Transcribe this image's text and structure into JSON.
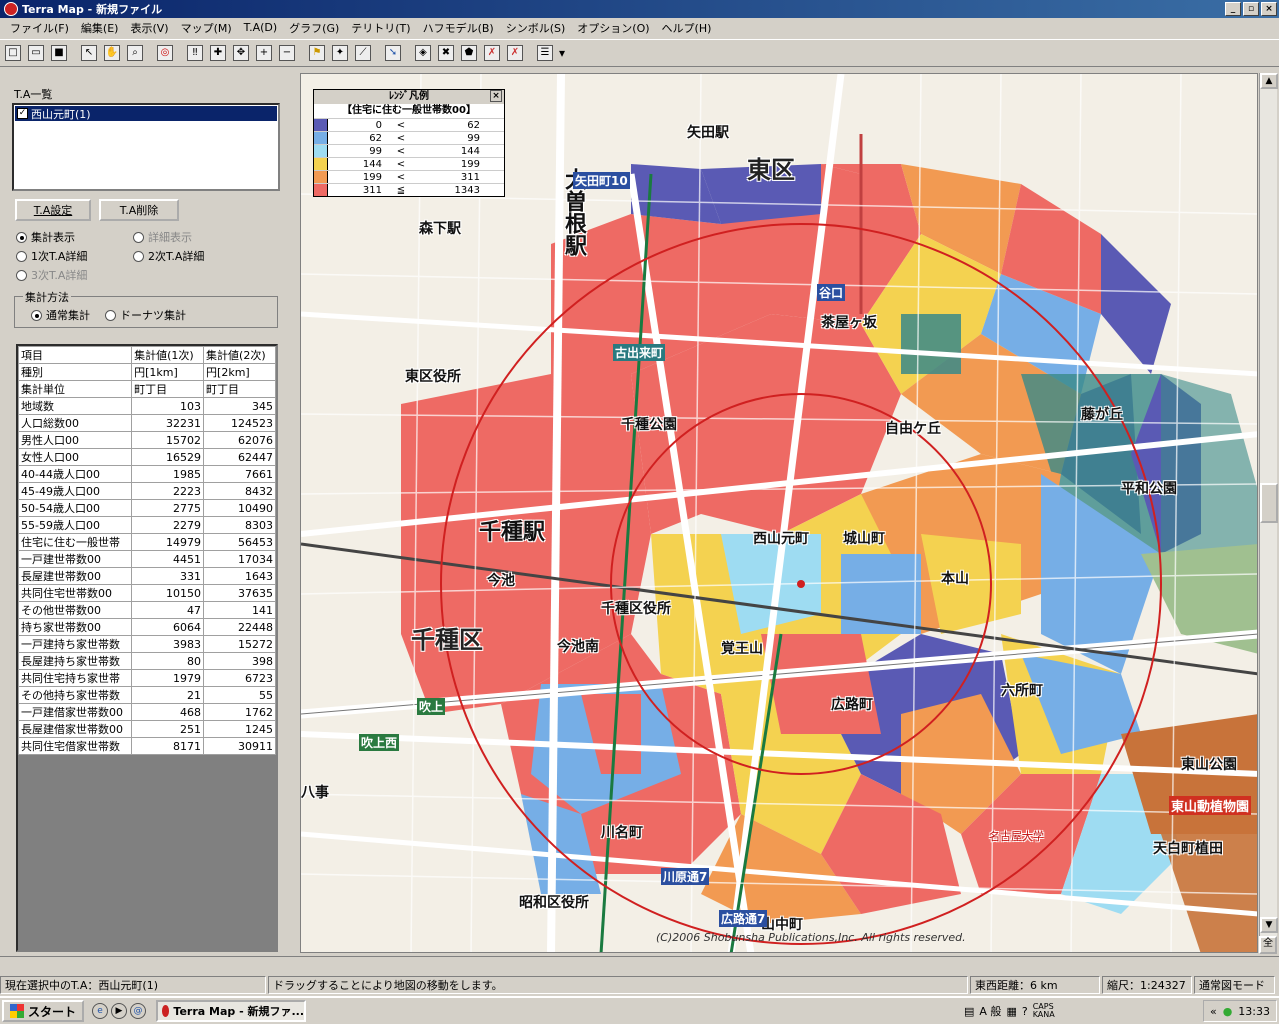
{
  "window": {
    "title": "Terra Map - 新規ファイル"
  },
  "menu": [
    "ファイル(F)",
    "編集(E)",
    "表示(V)",
    "マップ(M)",
    "T.A(D)",
    "グラフ(G)",
    "テリトリ(T)",
    "ハフモデル(B)",
    "シンボル(S)",
    "オプション(O)",
    "ヘルプ(H)"
  ],
  "left": {
    "ta_list_label": "T.A一覧",
    "ta_items": [
      "西山元町(1)"
    ],
    "btn_ta_setting": "T.A設定",
    "btn_ta_delete": "T.A削除",
    "radio_summary": "集計表示",
    "radio_detail": "詳細表示",
    "radio_ta1": "1次T.A詳細",
    "radio_ta2": "2次T.A詳細",
    "radio_ta3": "3次T.A詳細",
    "method_group": "集計方法",
    "method_normal": "通常集計",
    "method_donut": "ドーナツ集計"
  },
  "table": {
    "headers": [
      "項目",
      "集計値(1次)",
      "集計値(2次)"
    ],
    "rows": [
      [
        "種別",
        "円[1km]",
        "円[2km]"
      ],
      [
        "集計単位",
        "町丁目",
        "町丁目"
      ],
      [
        "地域数",
        "103",
        "345"
      ],
      [
        "人口総数00",
        "32231",
        "124523"
      ],
      [
        "男性人口00",
        "15702",
        "62076"
      ],
      [
        "女性人口00",
        "16529",
        "62447"
      ],
      [
        "40-44歳人口00",
        "1985",
        "7661"
      ],
      [
        "45-49歳人口00",
        "2223",
        "8432"
      ],
      [
        "50-54歳人口00",
        "2775",
        "10490"
      ],
      [
        "55-59歳人口00",
        "2279",
        "8303"
      ],
      [
        "住宅に住む一般世帯",
        "14979",
        "56453"
      ],
      [
        "一戸建世帯数00",
        "4451",
        "17034"
      ],
      [
        "長屋建世帯数00",
        "331",
        "1643"
      ],
      [
        "共同住宅世帯数00",
        "10150",
        "37635"
      ],
      [
        "その他世帯数00",
        "47",
        "141"
      ],
      [
        "持ち家世帯数00",
        "6064",
        "22448"
      ],
      [
        "一戸建持ち家世帯数",
        "3983",
        "15272"
      ],
      [
        "長屋建持ち家世帯数",
        "80",
        "398"
      ],
      [
        "共同住宅持ち家世帯",
        "1979",
        "6723"
      ],
      [
        "その他持ち家世帯数",
        "21",
        "55"
      ],
      [
        "一戸建借家世帯数00",
        "468",
        "1762"
      ],
      [
        "長屋建借家世帯数00",
        "251",
        "1245"
      ],
      [
        "共同住宅借家世帯数",
        "8171",
        "30911"
      ]
    ]
  },
  "legend": {
    "title": "ﾚﾝｼﾞ凡例",
    "subtitle": "【住宅に住む一般世帯数00】",
    "rows": [
      {
        "color": "#5a5ab4",
        "lo": "0",
        "op": "<",
        "hi": "62"
      },
      {
        "color": "#76aee6",
        "lo": "62",
        "op": "<",
        "hi": "99"
      },
      {
        "color": "#9edcf2",
        "lo": "99",
        "op": "<",
        "hi": "144"
      },
      {
        "color": "#f4d250",
        "lo": "144",
        "op": "<",
        "hi": "199"
      },
      {
        "color": "#f29a52",
        "lo": "199",
        "op": "<",
        "hi": "311"
      },
      {
        "color": "#ee6a64",
        "lo": "311",
        "op": "≦",
        "hi": "1343"
      }
    ]
  },
  "map": {
    "labels": {
      "higashi_ku": "東区",
      "chikusa_ku": "千種区",
      "chikusa_station": "千種駅",
      "chikusa_kuyakusho": "千種区役所",
      "imaike": "今池",
      "ozone": "大曽根駅",
      "yada": "矢田駅",
      "morishita": "森下駅",
      "higashi_kuyakusho": "東区役所",
      "showa_kuyakusho": "昭和区役所",
      "chayagasaka": "茶屋ヶ坂",
      "nishiyama_motomachi": "西山元町",
      "kakuozan": "覚王山",
      "fujigaoka": "藤が丘",
      "higashiyama": "東山公園",
      "heiwa_koen": "平和公園",
      "motoyama": "本山",
      "yagoto": "八事",
      "jiyugaoka": "自由ケ丘",
      "nakagawa": "城山町",
      "sakae": "吹上",
      "taniguchi": "谷口",
      "fukiage_west": "吹上西",
      "chikusa_park": "千種公園",
      "kawana": "川名町",
      "yamanaka": "山中町",
      "tokaidori": "広路通7",
      "kawarado": "川原通7",
      "higashiyama_zoo": "東山動植物園",
      "mutsu": "六所町",
      "tenpaku": "天白町植田",
      "hirobari": "広路町",
      "meidai": "名古屋大学",
      "yadacho": "矢田町10",
      "koide": "古出来町",
      "minami_ike": "今池南"
    },
    "copyright": "(C)2006 Shobunsha Publications,Inc. All rights reserved."
  },
  "status": {
    "selected": "現在選択中のT.A：西山元町(1)",
    "hint": "ドラッグすることにより地図の移動をします。",
    "ew_distance": "東西距離：6 km",
    "scale": "縮尺：1:24327",
    "mode": "通常図モード"
  },
  "taskbar": {
    "start": "スタート",
    "task": "Terra Map - 新規ファ...",
    "ime": "A 般",
    "caps": "CAPS",
    "kana": "KANA",
    "clock": "13:33"
  }
}
